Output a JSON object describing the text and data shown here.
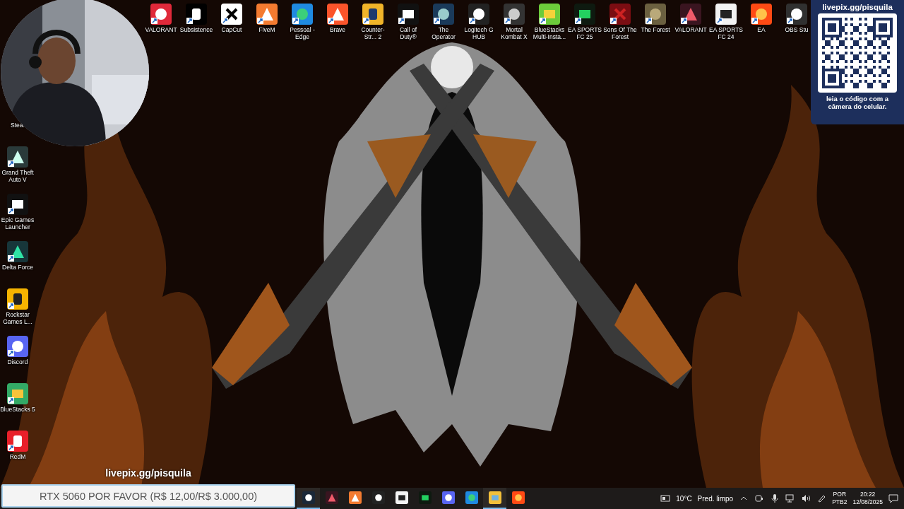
{
  "top_icons": [
    {
      "label": "VALORANT"
    },
    {
      "label": "Subsistence"
    },
    {
      "label": "CapCut"
    },
    {
      "label": "FiveM"
    },
    {
      "label": "Pessoal - Edge"
    },
    {
      "label": "Brave"
    },
    {
      "label": "Counter-Str... 2"
    },
    {
      "label": "Call of Duty®"
    },
    {
      "label": "The Operator"
    },
    {
      "label": "Logitech G HUB"
    },
    {
      "label": "Mortal Kombat X"
    },
    {
      "label": "BlueStacks Multi-Insta..."
    },
    {
      "label": "EA SPORTS FC 25"
    },
    {
      "label": "Sons Of The Forest"
    },
    {
      "label": "The Forest"
    },
    {
      "label": "VALORANT"
    },
    {
      "label": "EA SPORTS FC 24"
    },
    {
      "label": "EA"
    },
    {
      "label": "OBS Stu"
    }
  ],
  "left_icons": [
    {
      "label": "Stea."
    },
    {
      "label": "Grand Theft Auto V"
    },
    {
      "label": "Epic Games Launcher"
    },
    {
      "label": "Delta Force"
    },
    {
      "label": "Rockstar Games L..."
    },
    {
      "label": "Discord"
    },
    {
      "label": "BlueStacks 5"
    },
    {
      "label": "RedM"
    }
  ],
  "qr_panel": {
    "title": "livepix.gg/pisquila",
    "caption": "leia o código com a câmera do celular."
  },
  "overlay": {
    "link": "livepix.gg/pisquila",
    "goal": "RTX 5060 POR FAVOR (R$ 12,00/R$ 3.000,00)"
  },
  "taskbar": {
    "apps": [
      {
        "open": true
      },
      {
        "open": false
      },
      {
        "open": false
      },
      {
        "open": false
      },
      {
        "open": false
      },
      {
        "open": false
      },
      {
        "open": false
      },
      {
        "open": false
      },
      {
        "open": true
      },
      {
        "open": false
      }
    ],
    "weather": {
      "temperature": "10°C",
      "condition": "Pred. limpo"
    },
    "language": "POR",
    "layout": "PTB2",
    "time": "20:22",
    "date": "12/08/2025"
  }
}
